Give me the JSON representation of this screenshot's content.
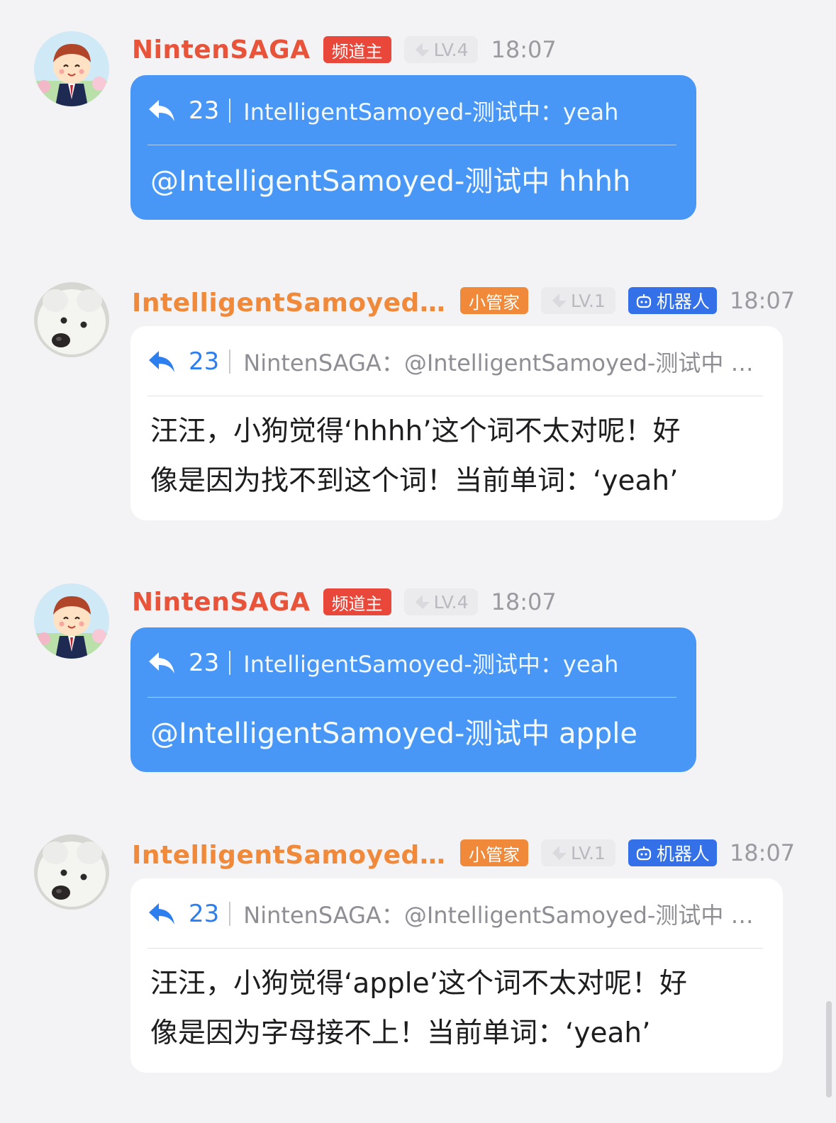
{
  "colors": {
    "owner_name": "#e8533a",
    "bot_name": "#f08a3a",
    "owner_badge_bg": "#e8473a",
    "steward_badge_bg": "#f08a3a",
    "bot_badge_bg": "#3470e8",
    "bubble_blue": "#4896f5",
    "bubble_white": "#ffffff",
    "quote_number_blue": "#2d7ff0"
  },
  "messages": [
    {
      "author": "NintenSAGA",
      "role_badge": "频道主",
      "level": "LV.4",
      "time": "18:07",
      "avatar": "villager-avatar",
      "quote_number": "23",
      "quote_text": "IntelligentSamoyed-测试中：yeah",
      "body": "@IntelligentSamoyed-测试中 hhhh"
    },
    {
      "author": "IntelligentSamoyed-测试中",
      "role_badge": "小管家",
      "level": "LV.1",
      "bot_badge": "机器人",
      "time": "18:07",
      "avatar": "samoyed-avatar",
      "quote_number": "23",
      "quote_text": "NintenSAGA：@IntelligentSamoyed-测试中 hhhh",
      "body_line1": "汪汪，小狗觉得‘hhhh’这个词不太对呢！好",
      "body_line2": "像是因为找不到这个词！当前单词：‘yeah’"
    },
    {
      "author": "NintenSAGA",
      "role_badge": "频道主",
      "level": "LV.4",
      "time": "18:07",
      "avatar": "villager-avatar",
      "quote_number": "23",
      "quote_text": "IntelligentSamoyed-测试中：yeah",
      "body": "@IntelligentSamoyed-测试中 apple"
    },
    {
      "author": "IntelligentSamoyed-测试中",
      "role_badge": "小管家",
      "level": "LV.1",
      "bot_badge": "机器人",
      "time": "18:07",
      "avatar": "samoyed-avatar",
      "quote_number": "23",
      "quote_text": "NintenSAGA：@IntelligentSamoyed-测试中 apple",
      "body_line1": "汪汪，小狗觉得‘apple’这个词不太对呢！好",
      "body_line2": "像是因为字母接不上！当前单词：‘yeah’"
    }
  ]
}
